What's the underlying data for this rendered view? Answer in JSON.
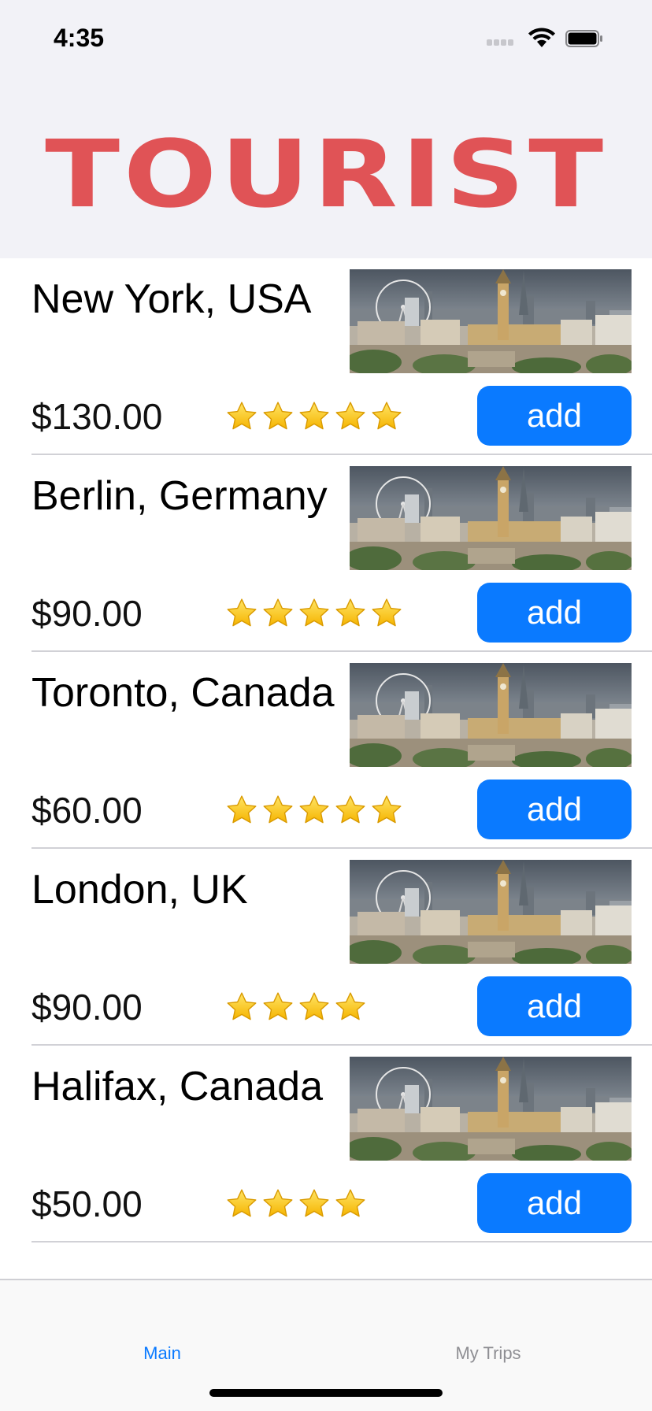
{
  "status_bar": {
    "time": "4:35",
    "icons": [
      "cellular-signal-icon",
      "wifi-icon",
      "battery-icon"
    ]
  },
  "header": {
    "logo_text": "TOURIST",
    "logo_color": "#e05356",
    "background": "#f2f2f7"
  },
  "accent_color": "#0a7aff",
  "destinations": [
    {
      "city": "New York, USA",
      "price": "$130.00",
      "rating": 5,
      "button": "add",
      "image": "london-skyline-photo"
    },
    {
      "city": "Berlin, Germany",
      "price": "$90.00",
      "rating": 5,
      "button": "add",
      "image": "london-skyline-photo"
    },
    {
      "city": "Toronto, Canada",
      "price": "$60.00",
      "rating": 5,
      "button": "add",
      "image": "london-skyline-photo"
    },
    {
      "city": "London, UK",
      "price": "$90.00",
      "rating": 4,
      "button": "add",
      "image": "london-skyline-photo"
    },
    {
      "city": "Halifax, Canada",
      "price": "$50.00",
      "rating": 4,
      "button": "add",
      "image": "london-skyline-photo"
    }
  ],
  "tab_bar": {
    "tabs": [
      {
        "label": "Main",
        "selected": true
      },
      {
        "label": "My Trips",
        "selected": false
      }
    ]
  }
}
